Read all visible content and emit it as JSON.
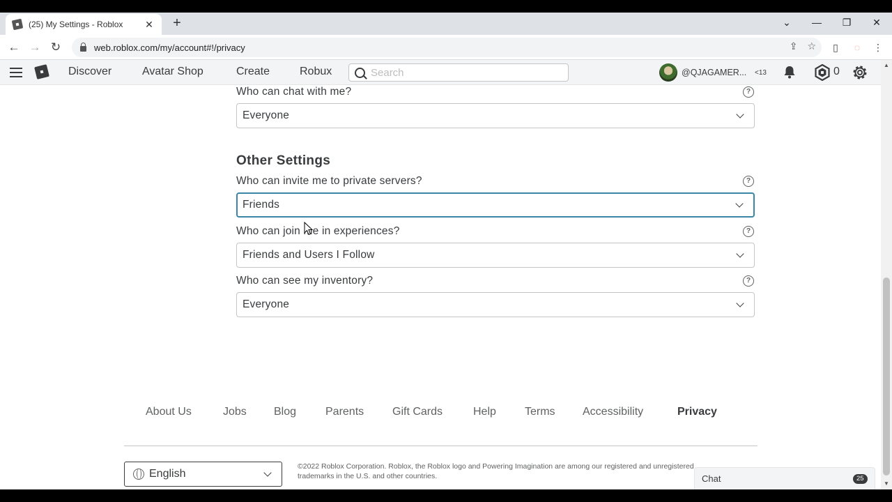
{
  "browser": {
    "tab_title": "(25) My Settings - Roblox",
    "url": "web.roblox.com/my/account#!/privacy"
  },
  "header": {
    "nav": [
      "Discover",
      "Avatar Shop",
      "Create",
      "Robux"
    ],
    "search_placeholder": "Search",
    "username": "@QJAGAMER...",
    "age_label": "<13",
    "robux": "0"
  },
  "privacy": {
    "chat": {
      "label": "Who can chat with me?",
      "value": "Everyone"
    },
    "other_title": "Other Settings",
    "invite": {
      "label": "Who can invite me to private servers?",
      "value": "Friends"
    },
    "join": {
      "label": "Who can join me in experiences?",
      "value": "Friends and Users I Follow"
    },
    "inventory": {
      "label": "Who can see my inventory?",
      "value": "Everyone"
    }
  },
  "footer": {
    "links": [
      "About Us",
      "Jobs",
      "Blog",
      "Parents",
      "Gift Cards",
      "Help",
      "Terms",
      "Accessibility",
      "Privacy"
    ],
    "language": "English",
    "copyright": "©2022 Roblox Corporation. Roblox, the Roblox logo and Powering Imagination are among our registered and unregistered trademarks in the U.S. and other countries."
  },
  "chat": {
    "label": "Chat",
    "badge": "25"
  }
}
